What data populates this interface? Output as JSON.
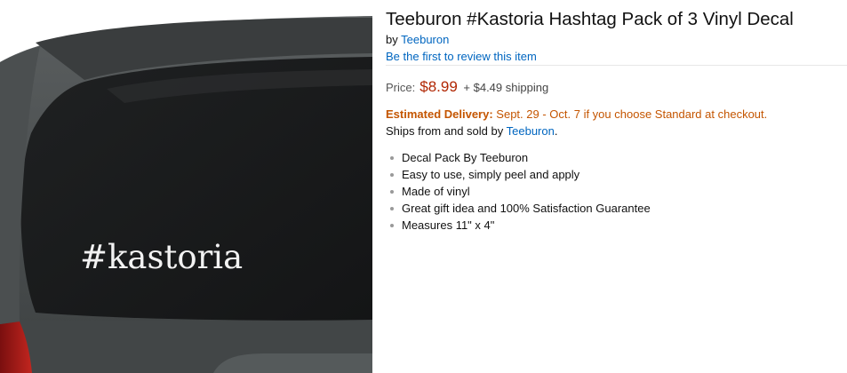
{
  "image": {
    "decal_text": "#kastoria"
  },
  "product": {
    "title": "Teeburon #Kastoria Hashtag Pack of 3 Vinyl Decal",
    "by_label": "by",
    "brand": "Teeburon",
    "review_link": "Be the first to review this item",
    "price_label": "Price:",
    "price": "$8.99",
    "shipping": "+ $4.49 shipping",
    "delivery_label": "Estimated Delivery:",
    "delivery_text": "Sept. 29 - Oct. 7 if you choose Standard at checkout.",
    "ships_prefix": "Ships from and sold by",
    "seller": "Teeburon",
    "ships_suffix": ".",
    "features": [
      "Decal Pack By Teeburon",
      "Easy to use, simply peel and apply",
      "Made of vinyl",
      "Great gift idea and 100% Satisfaction Guarantee",
      "Measures 11\" x 4\""
    ]
  },
  "colors": {
    "link": "#0066c0",
    "price": "#b12704",
    "delivery": "#c45500"
  }
}
